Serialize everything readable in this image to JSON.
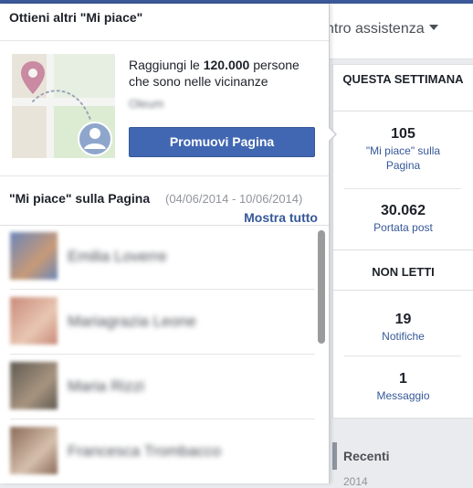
{
  "header": {
    "help_center": "ntro assistenza"
  },
  "stats": {
    "this_week_heading": "QUESTA SETTIMANA",
    "likes": {
      "value": "105",
      "label": "\"Mi piace\" sulla Pagina"
    },
    "reach": {
      "value": "30.062",
      "label": "Portata post"
    },
    "unread_heading": "NON LETTI",
    "notifications": {
      "value": "19",
      "label": "Notifiche"
    },
    "messages": {
      "value": "1",
      "label": "Messaggio"
    }
  },
  "recent": {
    "title": "Recenti",
    "year": "2014"
  },
  "popup": {
    "title": "Ottieni altri \"Mi piace\"",
    "promo_text_before": "Raggiungi le ",
    "promo_number": "120.000",
    "promo_text_after": " persone che sono nelle vicinanze",
    "promo_city": "Oleum",
    "promote_button": "Promuovi Pagina",
    "likes_title": "\"Mi piace\" sulla Pagina",
    "likes_range": "(04/06/2014 - 10/06/2014)",
    "show_all": "Mostra tutto",
    "people": [
      {
        "name": "Emilia Loverre",
        "colors": [
          "#6b86b8",
          "#c79a77"
        ]
      },
      {
        "name": "Mariagrazia Leone",
        "colors": [
          "#c98a7a",
          "#e8c7b2"
        ]
      },
      {
        "name": "Maria Rizzi",
        "colors": [
          "#5f5a52",
          "#a7947f"
        ]
      },
      {
        "name": "Francesca Trombacco",
        "colors": [
          "#8a6a57",
          "#d6c0ad"
        ]
      }
    ]
  },
  "colors": {
    "accent": "#4267b2",
    "link": "#365899",
    "topbar": "#3b5998"
  }
}
